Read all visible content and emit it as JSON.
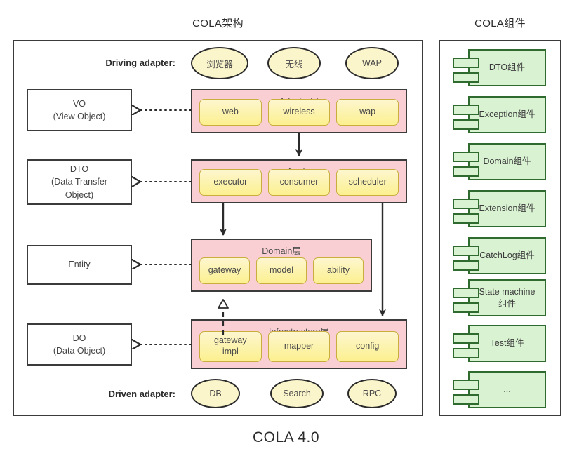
{
  "titles": {
    "architecture": "COLA架构",
    "components": "COLA组件"
  },
  "footer": "COLA 4.0",
  "labels": {
    "driving_adapter": "Driving adapter:",
    "driven_adapter": "Driven adapter:"
  },
  "driving_adapters": [
    {
      "name": "browser-ellipse",
      "label": "浏览器"
    },
    {
      "name": "wireless-ellipse",
      "label": "无线"
    },
    {
      "name": "wap-ellipse",
      "label": "WAP"
    }
  ],
  "driven_adapters": [
    {
      "name": "db-ellipse",
      "label": "DB"
    },
    {
      "name": "search-ellipse",
      "label": "Search"
    },
    {
      "name": "rpc-ellipse",
      "label": "RPC"
    }
  ],
  "models": [
    {
      "name": "vo-box",
      "line1": "VO",
      "line2": "(View Object)"
    },
    {
      "name": "dto-box",
      "line1": "DTO",
      "line2": "(Data Transfer",
      "line3": "Object)"
    },
    {
      "name": "entity-box",
      "line1": "Entity",
      "line2": ""
    },
    {
      "name": "do-box",
      "line1": "DO",
      "line2": "(Data Object)"
    }
  ],
  "layers": [
    {
      "name": "adapter-layer",
      "title": "Adapter层",
      "modules": [
        {
          "name": "module-web",
          "label": "web"
        },
        {
          "name": "module-wireless",
          "label": "wireless"
        },
        {
          "name": "module-wap",
          "label": "wap"
        }
      ]
    },
    {
      "name": "app-layer",
      "title": "App层",
      "modules": [
        {
          "name": "module-executor",
          "label": "executor"
        },
        {
          "name": "module-consumer",
          "label": "consumer"
        },
        {
          "name": "module-scheduler",
          "label": "scheduler"
        }
      ]
    },
    {
      "name": "domain-layer",
      "title": "Domain层",
      "modules": [
        {
          "name": "module-gateway",
          "label": "gateway"
        },
        {
          "name": "module-model",
          "label": "model"
        },
        {
          "name": "module-ability",
          "label": "ability"
        }
      ]
    },
    {
      "name": "infrastructure-layer",
      "title": "Infrastructure层",
      "modules": [
        {
          "name": "module-gateway-impl",
          "label": "gateway\nimpl"
        },
        {
          "name": "module-mapper",
          "label": "mapper"
        },
        {
          "name": "module-config",
          "label": "config"
        }
      ]
    }
  ],
  "components": [
    {
      "name": "component-dto",
      "label": "DTO组件"
    },
    {
      "name": "component-exception",
      "label": "Exception组件"
    },
    {
      "name": "component-domain",
      "label": "Domain组件"
    },
    {
      "name": "component-extension",
      "label": "Extension组件"
    },
    {
      "name": "component-catchlog",
      "label": "CatchLog组件"
    },
    {
      "name": "component-state-machine",
      "label": "State machine\n组件"
    },
    {
      "name": "component-test",
      "label": "Test组件"
    },
    {
      "name": "component-more",
      "label": "..."
    }
  ],
  "colors": {
    "layer_fill": "#f9cfd3",
    "module_fill": "#fcf08f",
    "component_fill": "#d9f2d2",
    "component_border": "#2f6b2f",
    "ellipse_fill": "#fbf5cc",
    "stroke": "#3b3b3b"
  }
}
